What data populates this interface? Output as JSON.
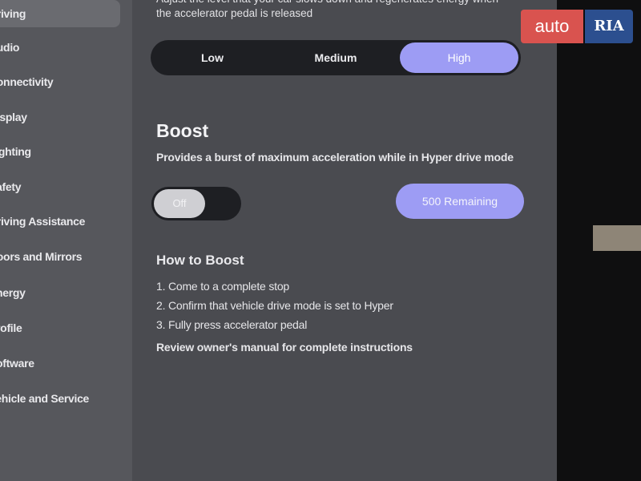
{
  "sidebar": {
    "items": [
      {
        "label": "Driving",
        "active": true
      },
      {
        "label": "Audio"
      },
      {
        "label": "Connectivity"
      },
      {
        "label": "Display"
      },
      {
        "label": "Lighting"
      },
      {
        "label": "Safety"
      },
      {
        "label": "Driving Assistance"
      },
      {
        "label": "Doors and Mirrors"
      },
      {
        "label": "Energy"
      },
      {
        "label": "Profile"
      },
      {
        "label": "Software"
      },
      {
        "label": "Vehicle and Service"
      }
    ]
  },
  "regen": {
    "description": "Adjust the level that your car slows down and regenerates energy when the accelerator pedal is released",
    "options": [
      "Low",
      "Medium",
      "High"
    ],
    "selected": "High"
  },
  "boost": {
    "title": "Boost",
    "description": "Provides a burst of maximum acceleration while in Hyper drive mode",
    "toggle_label": "Off",
    "remaining_label": "500 Remaining"
  },
  "how_to": {
    "title": "How to Boost",
    "steps": [
      "1. Come to a complete stop",
      "2. Confirm that vehicle drive mode is set to Hyper",
      "3. Fully press accelerator pedal"
    ],
    "note": "Review owner's manual for complete instructions"
  },
  "watermark": {
    "left": "auto",
    "right": "RIA"
  },
  "colors": {
    "accent": "#9d9cf4",
    "screen_bg": "#4a4b50",
    "sidebar_bg": "#56575c"
  }
}
